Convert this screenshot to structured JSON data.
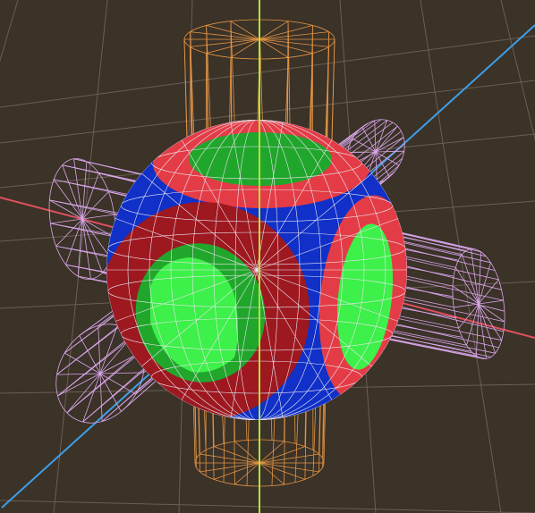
{
  "viewport": {
    "background": "#3b3228",
    "colors": {
      "grid_line": "#6a5f52",
      "axis_x": "#e0505f",
      "axis_y": "#b5e23a",
      "axis_z": "#3d9ee8",
      "sphere_body": "#1030c8",
      "ring_red": "#e43c46",
      "ring_dark_red": "#9e1820",
      "hole_green": "#21a62c",
      "hole_light_green": "#3ef04a",
      "wire_orange": "#e39443",
      "wire_pink": "#d9a7ea",
      "wire_white": "#e9e7ee"
    },
    "objects": [
      {
        "name": "sphere-with-cut-holes",
        "wireframe": false
      },
      {
        "name": "vertical-cylinder-wireframe",
        "wireframe": true
      },
      {
        "name": "horizontal-cylinder-wireframe",
        "wireframe": true
      },
      {
        "name": "depth-cylinder-wireframe",
        "wireframe": true
      }
    ]
  }
}
